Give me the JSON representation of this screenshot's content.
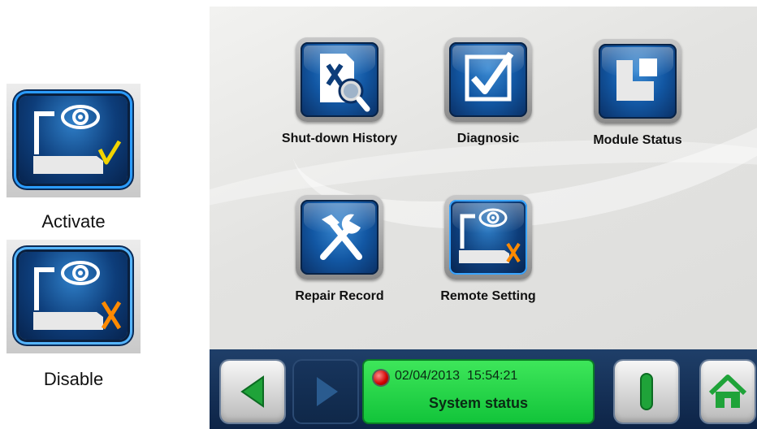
{
  "legend": {
    "activate": {
      "label": "Activate",
      "icon": "remote-activate-icon",
      "mark_color": "#f2d400"
    },
    "disable": {
      "label": "Disable",
      "icon": "remote-disable-icon",
      "mark_color": "#ff8a00"
    }
  },
  "menu": {
    "items": [
      {
        "label": "Shut-down History",
        "icon": "shutdown-history-icon"
      },
      {
        "label": "Diagnosic",
        "icon": "checkbox-icon"
      },
      {
        "label": "Module Status",
        "icon": "module-status-icon"
      },
      {
        "label": "Repair Record",
        "icon": "tools-icon"
      },
      {
        "label": "Remote Setting",
        "icon": "remote-disable-icon"
      }
    ]
  },
  "status_bar": {
    "datetime": "02/04/2013  15:54:21",
    "caption": "System status",
    "indicator_color": "#d00000",
    "panel_color": "#22d44a",
    "buttons": [
      {
        "name": "back-button",
        "icon": "left-arrow-icon"
      },
      {
        "name": "forward-button",
        "icon": "right-arrow-icon"
      },
      {
        "name": "power-button",
        "icon": "power-icon"
      },
      {
        "name": "home-button",
        "icon": "home-icon"
      }
    ]
  }
}
